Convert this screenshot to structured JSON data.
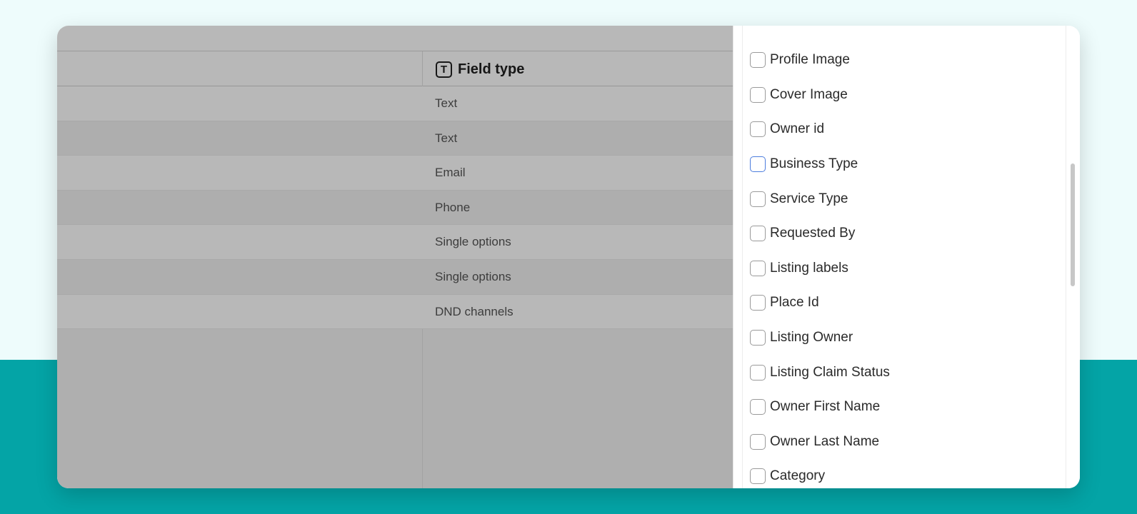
{
  "table": {
    "column_header": "Field type",
    "column_icon": "text-type-icon",
    "rows": [
      {
        "type": "Text"
      },
      {
        "type": "Text"
      },
      {
        "type": "Email"
      },
      {
        "type": "Phone"
      },
      {
        "type": "Single options"
      },
      {
        "type": "Single options"
      },
      {
        "type": "DND channels"
      }
    ]
  },
  "panel": {
    "items": [
      {
        "label": "Profile Image",
        "checked": false
      },
      {
        "label": "Cover Image",
        "checked": false
      },
      {
        "label": "Owner id",
        "checked": false
      },
      {
        "label": "Business Type",
        "checked": false
      },
      {
        "label": "Service Type",
        "checked": false
      },
      {
        "label": "Requested By",
        "checked": false
      },
      {
        "label": "Listing labels",
        "checked": false
      },
      {
        "label": "Place Id",
        "checked": false
      },
      {
        "label": "Listing Owner",
        "checked": false
      },
      {
        "label": "Listing Claim Status",
        "checked": false
      },
      {
        "label": "Owner First Name",
        "checked": false
      },
      {
        "label": "Owner Last Name",
        "checked": false
      },
      {
        "label": "Category",
        "checked": false
      }
    ]
  },
  "colors": {
    "background_light": "#eefcfc",
    "background_teal": "#04a4a6",
    "focus_blue": "#4c7ddd"
  }
}
